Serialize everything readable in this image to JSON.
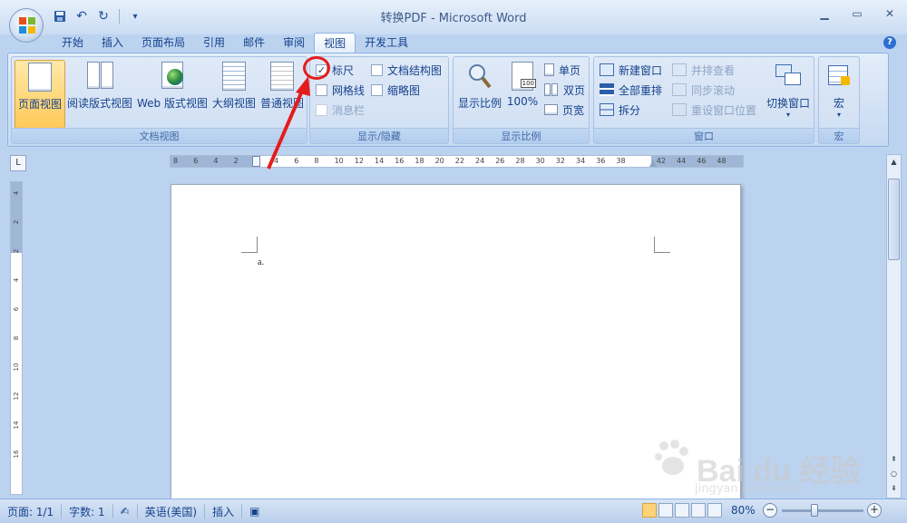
{
  "window": {
    "title": "转换PDF - Microsoft Word",
    "controls": [
      "minimize-icon",
      "restore-icon",
      "close-icon"
    ]
  },
  "quick_access": {
    "items": [
      "save-icon",
      "undo-icon",
      "redo-icon",
      "customize-icon"
    ]
  },
  "tabs": [
    {
      "label": "开始",
      "active": false
    },
    {
      "label": "插入",
      "active": false
    },
    {
      "label": "页面布局",
      "active": false
    },
    {
      "label": "引用",
      "active": false
    },
    {
      "label": "邮件",
      "active": false
    },
    {
      "label": "审阅",
      "active": false
    },
    {
      "label": "视图",
      "active": true
    },
    {
      "label": "开发工具",
      "active": false
    }
  ],
  "ribbon": {
    "doc_views": {
      "label": "文档视图",
      "buttons": [
        {
          "label": "页面视图",
          "active": true
        },
        {
          "label": "阅读版式视图",
          "active": false
        },
        {
          "label": "Web 版式视图",
          "active": false
        },
        {
          "label": "大纲视图",
          "active": false
        },
        {
          "label": "普通视图",
          "active": false
        }
      ]
    },
    "show_hide": {
      "label": "显示/隐藏",
      "ruler": {
        "label": "标尺",
        "checked": true
      },
      "gridlines": {
        "label": "网格线",
        "checked": false
      },
      "message_bar": {
        "label": "消息栏",
        "checked": false,
        "disabled": true
      },
      "doc_map": {
        "label": "文档结构图",
        "checked": false
      },
      "thumbnails": {
        "label": "缩略图",
        "checked": false
      }
    },
    "zoom": {
      "label": "显示比例",
      "zoom_button": "显示比例",
      "hundred": "100%",
      "one_page": "单页",
      "two_pages": "双页",
      "page_width": "页宽",
      "hundred_badge": "100"
    },
    "window": {
      "label": "窗口",
      "new_window": "新建窗口",
      "arrange_all": "全部重排",
      "split": "拆分",
      "side_by_side": "并排查看",
      "sync_scroll": "同步滚动",
      "reset_position": "重设窗口位置",
      "switch_windows": "切换窗口"
    },
    "macros": {
      "label": "宏",
      "button": "宏"
    }
  },
  "ruler": {
    "corner": "L",
    "h_ticks": [
      "8",
      "6",
      "4",
      "2",
      "2",
      "4",
      "6",
      "8",
      "10",
      "12",
      "14",
      "16",
      "18",
      "20",
      "22",
      "24",
      "26",
      "28",
      "30",
      "32",
      "34",
      "36",
      "38",
      "42",
      "44",
      "46",
      "48"
    ],
    "v_ticks": [
      "4",
      "2",
      "2",
      "4",
      "6",
      "8",
      "10",
      "12",
      "14",
      "16"
    ]
  },
  "document": {
    "paragraph": "a."
  },
  "statusbar": {
    "page": "页面: 1/1",
    "words": "字数: 1",
    "language": "英语(美国)",
    "mode": "插入",
    "zoom": "80%",
    "zoom_level": 0.4
  },
  "watermark": {
    "brand": "Bai du 经验",
    "url": "jingyan.baidu.com"
  },
  "colors": {
    "annotation": "#e51c1c",
    "active_button": "#ffc95a",
    "ribbon_bg": "#dfe9f7"
  }
}
